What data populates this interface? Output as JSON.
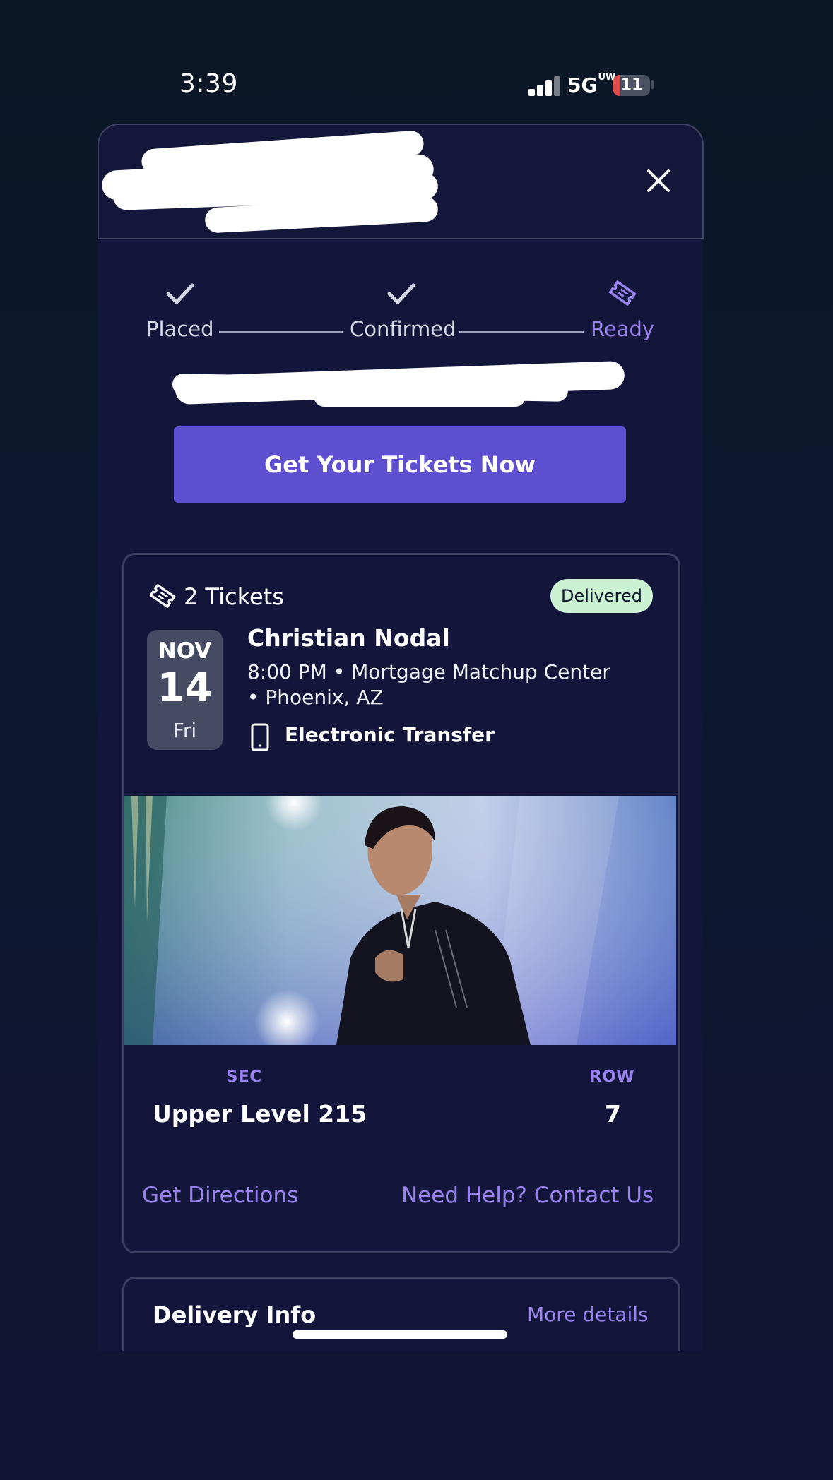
{
  "status_bar": {
    "time": "3:39",
    "network": "5G",
    "network_suffix": "UW",
    "battery": "11"
  },
  "progress": {
    "steps": [
      {
        "label": "Placed",
        "state": "done",
        "icon": "check-icon"
      },
      {
        "label": "Confirmed",
        "state": "done",
        "icon": "check-icon"
      },
      {
        "label": "Ready",
        "state": "current",
        "icon": "ticket-icon"
      }
    ]
  },
  "cta": {
    "label": "Get Your Tickets Now"
  },
  "ticket_card": {
    "tickets_count": "2 Tickets",
    "status_badge": "Delivered",
    "date": {
      "month": "NOV",
      "day": "14",
      "weekday": "Fri"
    },
    "event_title": "Christian Nodal",
    "event_meta_line1": "8:00 PM • Mortgage Matchup Center",
    "event_meta_line2": "• Phoenix, AZ",
    "delivery_method": "Electronic Transfer",
    "section_label": "SEC",
    "section_value": "Upper Level 215",
    "row_label": "ROW",
    "row_value": "7",
    "directions_link": "Get Directions",
    "help_link": "Need Help? Contact Us"
  },
  "delivery_card": {
    "title": "Delivery Info",
    "more_link": "More details"
  },
  "colors": {
    "accent": "#9a83ef",
    "button": "#5e4fd0",
    "sheet": "#13163a",
    "badge": "#c9f1d2"
  }
}
